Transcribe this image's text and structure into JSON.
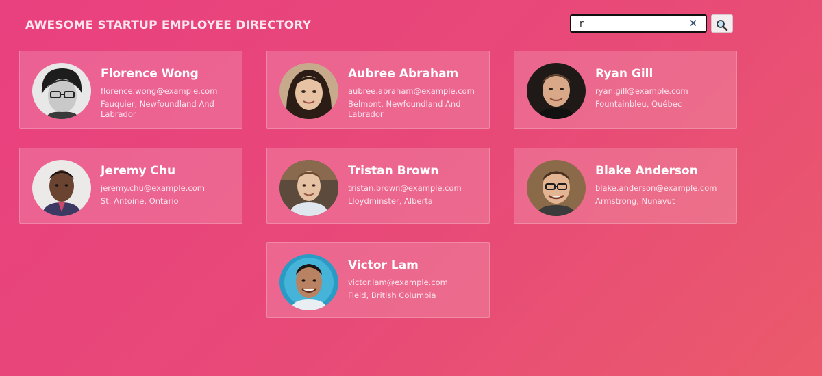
{
  "header": {
    "title": "AWESOME STARTUP EMPLOYEE DIRECTORY"
  },
  "search": {
    "value": "r",
    "clear_icon": "close-icon",
    "submit_icon": "magnifier-icon"
  },
  "colors": {
    "background_start": "#e9407f",
    "background_end": "#ea5a6b",
    "card_overlay": "rgba(255,255,255,0.17)"
  },
  "employees": [
    {
      "name": "Florence Wong",
      "email": "florence.wong@example.com",
      "location": "Fauquier, Newfoundland And Labrador"
    },
    {
      "name": "Aubree Abraham",
      "email": "aubree.abraham@example.com",
      "location": "Belmont, Newfoundland And Labrador"
    },
    {
      "name": "Ryan Gill",
      "email": "ryan.gill@example.com",
      "location": "Fountainbleu, Québec"
    },
    {
      "name": "Jeremy Chu",
      "email": "jeremy.chu@example.com",
      "location": "St. Antoine, Ontario"
    },
    {
      "name": "Tristan Brown",
      "email": "tristan.brown@example.com",
      "location": "Lloydminster, Alberta"
    },
    {
      "name": "Blake Anderson",
      "email": "blake.anderson@example.com",
      "location": "Armstrong, Nunavut"
    },
    {
      "name": "Victor Lam",
      "email": "victor.lam@example.com",
      "location": "Field, British Columbia"
    }
  ]
}
